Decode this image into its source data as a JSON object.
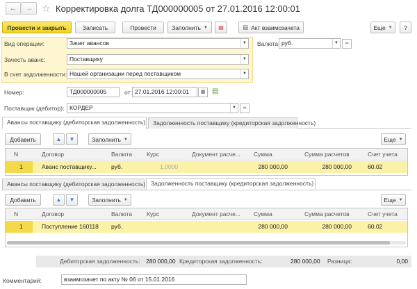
{
  "window": {
    "title": "Корректировка долга ТД000000005 от 27.01.2016 12:00:01"
  },
  "toolbar": {
    "post_close": "Провести и закрыть",
    "save": "Записать",
    "post": "Провести",
    "fill": "Заполнить",
    "act": "Акт взаимозачета",
    "more": "Еще"
  },
  "form": {
    "op_type_label": "Вид операции:",
    "op_type_value": "Зачет авансов",
    "offset_label": "Зачесть аванс:",
    "offset_value": "Поставщику",
    "against_label": "В счет задолженности:",
    "against_value": "Нашей организации перед поставщиком",
    "currency_label": "Валюта:",
    "currency_value": "руб.",
    "number_label": "Номер:",
    "number_value": "ТД000000005",
    "date_label": "от:",
    "date_value": "27.01.2016 12:00:01",
    "supplier_label": "Поставщик (дебитор):",
    "supplier_value": "КОРДЕР"
  },
  "section1": {
    "tabs": [
      "Авансы поставщику (дебиторская задолженность)",
      "Задолженность поставщику (кредиторская задолженность)"
    ],
    "add": "Добавить",
    "fill": "Заполнить",
    "more": "Еще",
    "columns": [
      "N",
      "Договор",
      "Валюта",
      "Курс",
      "Документ расче...",
      "Сумма",
      "Сумма расчетов",
      "Счет учета"
    ],
    "row": {
      "n": "1",
      "contract": "Аванс поставщику...",
      "currency": "руб.",
      "rate": "1,0000",
      "doc": "",
      "sum": "280 000,00",
      "sum_calc": "280 000,00",
      "account": "60.02"
    }
  },
  "section2": {
    "tabs": [
      "Авансы поставщику (дебиторская задолженность)",
      "Задолженность поставщику (кредиторская задолженность)"
    ],
    "add": "Добавить",
    "fill": "Заполнить",
    "more": "Еще",
    "columns": [
      "N",
      "Договор",
      "Валюта",
      "Курс",
      "Документ расче...",
      "Сумма",
      "Сумма расчетов",
      "Счет учета"
    ],
    "row": {
      "n": "1",
      "contract": "Поступление 160118",
      "currency": "руб.",
      "rate": "",
      "doc": "",
      "sum": "280 000,00",
      "sum_calc": "280 000,00",
      "account": "60.02"
    }
  },
  "totals": {
    "debit_label": "Дебиторская задолженность:",
    "debit_value": "280 000,00",
    "credit_label": "Кредиторская задолженность:",
    "credit_value": "280 000,00",
    "diff_label": "Разница:",
    "diff_value": "0,00"
  },
  "comment": {
    "label": "Комментарий:",
    "value": "взаимозачет  по акту № 06 от 15.01.2016"
  },
  "colors": {
    "accent_yellow": "#f2d21b",
    "selected_row": "#fbf1a7",
    "required_field_bg": "#fdf6d0"
  }
}
